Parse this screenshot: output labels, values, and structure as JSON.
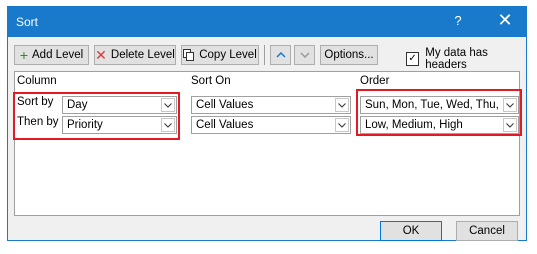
{
  "window": {
    "title": "Sort",
    "help": "?",
    "close": "✕"
  },
  "toolbar": {
    "add_level": "Add Level",
    "delete_level": "Delete Level",
    "copy_level": "Copy Level",
    "options": "Options...",
    "headers_label": "My data has headers",
    "headers_checked": true
  },
  "columns": {
    "column": "Column",
    "sort_on": "Sort On",
    "order": "Order"
  },
  "rows": [
    {
      "label": "Sort by",
      "column": "Day",
      "sort_on": "Cell Values",
      "order": "Sun, Mon, Tue, Wed, Thu, Fri, Sat"
    },
    {
      "label": "Then by",
      "column": "Priority",
      "sort_on": "Cell Values",
      "order": "Low, Medium, High"
    }
  ],
  "footer": {
    "ok": "OK",
    "cancel": "Cancel"
  },
  "colors": {
    "accent": "#1979ca",
    "highlight": "#e21a23"
  }
}
